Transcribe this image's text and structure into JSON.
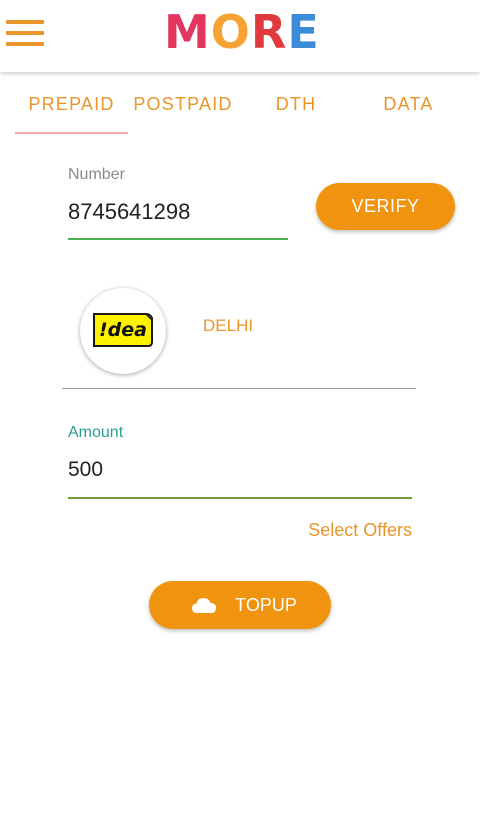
{
  "header": {
    "logo_letters": [
      "M",
      "O",
      "R",
      "E"
    ],
    "menu_icon": "hamburger-menu-icon"
  },
  "tabs": [
    {
      "label": "PREPAID",
      "selected": true
    },
    {
      "label": "POSTPAID",
      "selected": false
    },
    {
      "label": "DTH",
      "selected": false
    },
    {
      "label": "DATA",
      "selected": false
    }
  ],
  "number_field": {
    "label": "Number",
    "value": "8745641298"
  },
  "verify_button": {
    "label": "VERIFY"
  },
  "operator": {
    "logo_text": "!dea",
    "circle": "DELHI"
  },
  "amount_field": {
    "label": "Amount",
    "value": "500"
  },
  "select_offers": {
    "label": "Select Offers"
  },
  "topup_button": {
    "label": "TOPUP",
    "icon": "cloud-icon"
  },
  "colors": {
    "accent": "#f0930f",
    "tab_text": "#e9952a",
    "tab_indicator": "#f4a6a9",
    "number_underline": "#4caf50",
    "amount_underline": "#7a9a3a",
    "amount_label": "#2a9d8f",
    "number_label": "#8a8a8a",
    "idea_yellow": "#fff200"
  }
}
